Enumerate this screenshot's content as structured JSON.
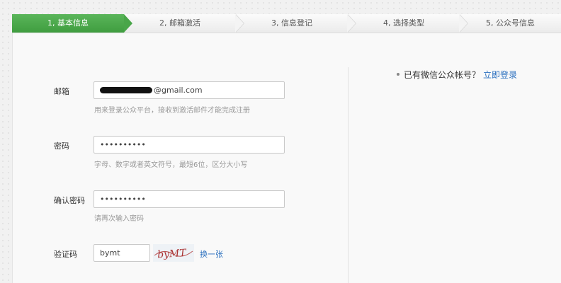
{
  "steps": [
    {
      "label": "1, 基本信息",
      "active": true
    },
    {
      "label": "2, 邮箱激活",
      "active": false
    },
    {
      "label": "3, 信息登记",
      "active": false
    },
    {
      "label": "4, 选择类型",
      "active": false
    },
    {
      "label": "5, 公众号信息",
      "active": false
    }
  ],
  "form": {
    "email": {
      "label": "邮箱",
      "value": "@gmail.com",
      "hint": "用来登录公众平台，接收到激活邮件才能完成注册"
    },
    "password": {
      "label": "密码",
      "value": "••••••••••",
      "hint": "字母、数字或者英文符号，最短6位，区分大小写"
    },
    "confirm": {
      "label": "确认密码",
      "value": "••••••••••",
      "hint": "请再次输入密码"
    },
    "captcha": {
      "label": "验证码",
      "value": "bymt",
      "image_text": "byMT",
      "refresh_label": "换一张"
    }
  },
  "side": {
    "have_account": "已有微信公众帐号？",
    "login_link": "立即登录"
  },
  "colors": {
    "active_step": "#4aa84a",
    "link": "#2a6fbf"
  }
}
